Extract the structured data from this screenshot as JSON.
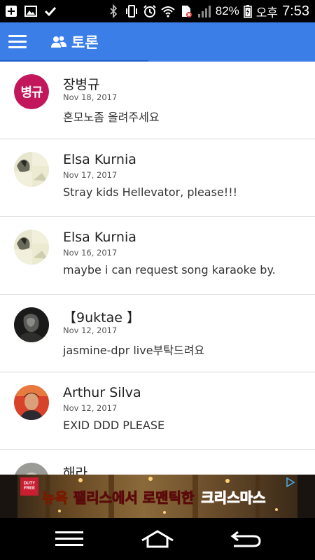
{
  "status_bar": {
    "battery_percent": "82%",
    "ampm": "오후",
    "time": "7:53",
    "icons": [
      "add-box-icon",
      "image-icon",
      "check-icon",
      "bluetooth-icon",
      "vibrate-icon",
      "alarm-icon",
      "wifi-icon",
      "sim-icon",
      "signal-icon",
      "battery-charging-icon"
    ]
  },
  "app_bar": {
    "title": "토론",
    "title_icon": "people-icon",
    "color": "#3b7ee8"
  },
  "comments": [
    {
      "avatar_text": "병규",
      "name": "장병규",
      "date": "Nov 18, 2017",
      "message": "혼모노좀 올려주세요"
    },
    {
      "avatar_text": "",
      "name": "Elsa Kurnia",
      "date": "Nov 17, 2017",
      "message": "Stray kids Hellevator, please!!!"
    },
    {
      "avatar_text": "",
      "name": "Elsa Kurnia",
      "date": "Nov 16, 2017",
      "message": "maybe i can request song karaoke by."
    },
    {
      "avatar_text": "",
      "name": "【9uktae 】",
      "date": "Nov 12, 2017",
      "message": "jasmine-dpr live부탁드려요"
    },
    {
      "avatar_text": "",
      "name": "Arthur Silva",
      "date": "Nov 12, 2017",
      "message": "EXID DDD PLEASE"
    },
    {
      "avatar_text": "",
      "name": "해라",
      "date": "",
      "message": ""
    }
  ],
  "ad": {
    "logo_text": "DUTY FREE",
    "headline_part1": "뉴욕",
    "headline_part2": "팰리스에서 로맨틱한",
    "headline_part3": "크리스마스"
  },
  "nav_bar": {
    "icons": [
      "menu-icon",
      "home-icon",
      "back-icon"
    ]
  }
}
